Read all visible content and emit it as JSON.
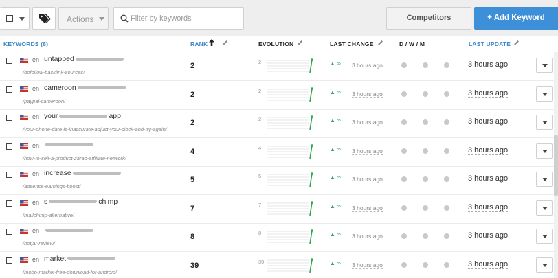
{
  "toolbar": {
    "actions_label": "Actions",
    "search_placeholder": "Filter by keywords",
    "competitors_label": "Competitors",
    "add_keyword_label": "Add Keyword",
    "add_icon": "+"
  },
  "header": {
    "keywords": "KEYWORDS (8)",
    "rank": "RANK",
    "evolution": "EVOLUTION",
    "last_change": "LAST CHANGE",
    "dwm": "D / W / M",
    "last_update": "LAST UPDATE"
  },
  "colors": {
    "accent": "#3d8fd8",
    "header_link": "#3a87c9",
    "positive": "#38a169",
    "sparkline": "#2fa84f"
  },
  "rows": [
    {
      "lang": "en",
      "keyword": "untapped",
      "url": "/dofollow-backlink-sources/",
      "rank": "2",
      "evolution": "2",
      "change": "▲ ∞",
      "change_time": "3 hours ago",
      "last_update": "3 hours ago"
    },
    {
      "lang": "en",
      "keyword": "cameroon",
      "url": "/paypal-cameroon/",
      "rank": "2",
      "evolution": "2",
      "change": "▲ ∞",
      "change_time": "3 hours ago",
      "last_update": "3 hours ago"
    },
    {
      "lang": "en",
      "keyword": "your",
      "keyword_tail": "app",
      "url": "/your-phone-date-is-inaccurate-adjust-your-clock-and-try-again/",
      "rank": "2",
      "evolution": "2",
      "change": "▲ ∞",
      "change_time": "3 hours ago",
      "last_update": "3 hours ago"
    },
    {
      "lang": "en",
      "keyword": "",
      "url": "/how-to-sell-a-product-zarao-affiliate-network/",
      "rank": "4",
      "evolution": "4",
      "change": "▲ ∞",
      "change_time": "3 hours ago",
      "last_update": "3 hours ago"
    },
    {
      "lang": "en",
      "keyword": "increase",
      "url": "/adsense-earnings-boost/",
      "rank": "5",
      "evolution": "5",
      "change": "▲ ∞",
      "change_time": "3 hours ago",
      "last_update": "3 hours ago"
    },
    {
      "lang": "en",
      "keyword": "s",
      "keyword_tail": "chimp",
      "url": "/mailchimp-alternative/",
      "rank": "7",
      "evolution": "7",
      "change": "▲ ∞",
      "change_time": "3 hours ago",
      "last_update": "3 hours ago"
    },
    {
      "lang": "en",
      "keyword": "",
      "url": "/hotjar-review/",
      "rank": "8",
      "evolution": "8",
      "change": "▲ ∞",
      "change_time": "3 hours ago",
      "last_update": "3 hours ago"
    },
    {
      "lang": "en",
      "keyword": "market",
      "url": "/mobo-market-free-download-for-android/",
      "rank": "39",
      "evolution": "39",
      "change": "▲ ∞",
      "change_time": "3 hours ago",
      "last_update": "3 hours ago"
    }
  ]
}
